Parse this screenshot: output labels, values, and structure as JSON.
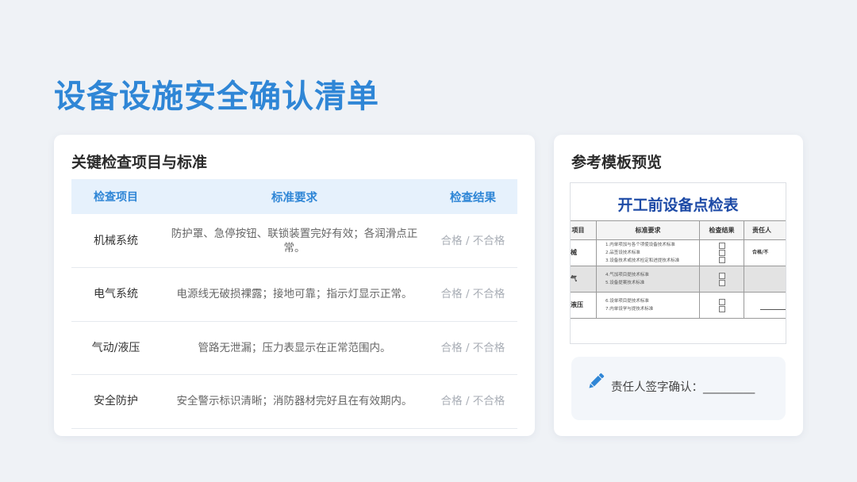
{
  "page": {
    "title": "设备设施安全确认清单"
  },
  "left_card": {
    "heading": "关键检查项目与标准",
    "columns": [
      "检查项目",
      "标准要求",
      "检查结果"
    ],
    "rows": [
      {
        "item": "机械系统",
        "standard": "防护罩、急停按钮、联锁装置完好有效；各润滑点正常。",
        "result": "合格 / 不合格"
      },
      {
        "item": "电气系统",
        "standard": "电源线无破损裸露；接地可靠；指示灯显示正常。",
        "result": "合格 / 不合格"
      },
      {
        "item": "气动/液压",
        "standard": "管路无泄漏；压力表显示在正常范围内。",
        "result": "合格 / 不合格"
      },
      {
        "item": "安全防护",
        "standard": "安全警示标识清晰；消防器材完好且在有效期内。",
        "result": "合格 / 不合格"
      }
    ]
  },
  "right_card": {
    "heading": "参考模板预览",
    "preview": {
      "title": "开工前设备点检表",
      "columns": [
        "项目",
        "标准要求",
        "检查结果",
        "责任人"
      ],
      "rows": [
        {
          "label": "械",
          "lines": [
            "1.内单项加与各个项使设备技术标准",
            "2.品签设技术标准",
            "3.设备技术或技术检定和进提技术标准"
          ],
          "person": "合格/不"
        },
        {
          "label": "气",
          "lines": [
            "4.气加项目提技术标准",
            "5.设备提案技术标准"
          ],
          "person": ""
        },
        {
          "label": "液压",
          "lines": [
            "6.设单项目提技术标准",
            "7.内单设学与提技术标准"
          ],
          "person": ""
        }
      ]
    },
    "signature": {
      "label": "责任人签字确认：",
      "blank": "_________"
    }
  },
  "colors": {
    "accent": "#2f86d6",
    "header_bg": "#e6f1fc",
    "background": "#eff2f6"
  }
}
